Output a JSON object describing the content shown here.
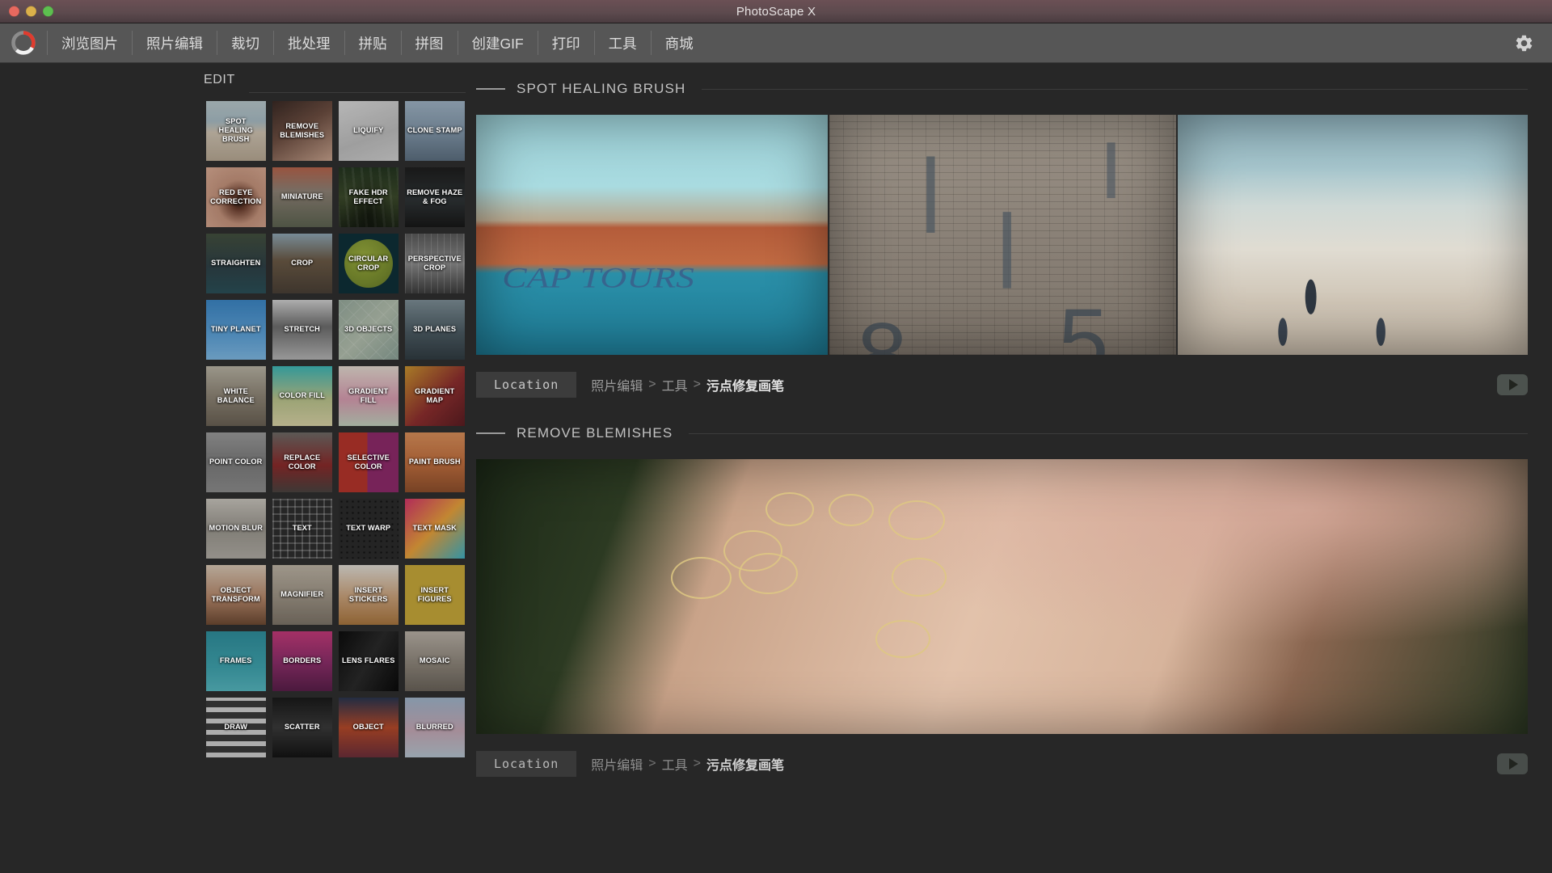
{
  "window": {
    "title": "PhotoScape X",
    "traffic_lights": [
      "close",
      "minimize",
      "maximize"
    ]
  },
  "menubar": {
    "logo": "photoscape-logo",
    "items": [
      {
        "label": "浏览图片"
      },
      {
        "label": "照片编辑"
      },
      {
        "label": "裁切"
      },
      {
        "label": "批处理"
      },
      {
        "label": "拼贴"
      },
      {
        "label": "拼图"
      },
      {
        "label": "创建GIF"
      },
      {
        "label": "打印"
      },
      {
        "label": "工具"
      },
      {
        "label": "商城"
      }
    ],
    "settings_icon": "gear-icon"
  },
  "sidebar": {
    "heading": "EDIT",
    "tiles": [
      {
        "label": "SPOT HEALING BRUSH",
        "art": "g-beach"
      },
      {
        "label": "REMOVE BLEMISHES",
        "art": "g-neck"
      },
      {
        "label": "LIQUIFY",
        "art": "g-liquify"
      },
      {
        "label": "CLONE STAMP",
        "art": "g-clone"
      },
      {
        "label": "RED EYE CORRECTION",
        "art": "g-eye"
      },
      {
        "label": "MINIATURE",
        "art": "g-mini"
      },
      {
        "label": "FAKE HDR EFFECT",
        "art": "g-hdr"
      },
      {
        "label": "REMOVE HAZE & FOG",
        "art": "g-haze"
      },
      {
        "label": "STRAIGHTEN",
        "art": "g-straight"
      },
      {
        "label": "CROP",
        "art": "g-crop"
      },
      {
        "label": "CIRCULAR CROP",
        "art": "g-circcrop"
      },
      {
        "label": "PERSPECTIVE CROP",
        "art": "g-persp"
      },
      {
        "label": "TINY PLANET",
        "art": "g-tiny"
      },
      {
        "label": "STRETCH",
        "art": "g-stretch"
      },
      {
        "label": "3D OBJECTS",
        "art": "g-3dobj"
      },
      {
        "label": "3D PLANES",
        "art": "g-3dpl"
      },
      {
        "label": "WHITE BALANCE",
        "art": "g-wb"
      },
      {
        "label": "COLOR FILL",
        "art": "g-cfill"
      },
      {
        "label": "GRADIENT FILL",
        "art": "g-gfill"
      },
      {
        "label": "GRADIENT MAP",
        "art": "g-gmap"
      },
      {
        "label": "POINT COLOR",
        "art": "g-pcolor"
      },
      {
        "label": "REPLACE COLOR",
        "art": "g-rcolor"
      },
      {
        "label": "SELECTIVE COLOR",
        "art": "g-scolor"
      },
      {
        "label": "PAINT BRUSH",
        "art": "g-paint"
      },
      {
        "label": "MOTION BLUR",
        "art": "g-motion"
      },
      {
        "label": "TEXT",
        "art": "g-text"
      },
      {
        "label": "TEXT WARP",
        "art": "g-twarp"
      },
      {
        "label": "TEXT MASK",
        "art": "g-tmask"
      },
      {
        "label": "OBJECT TRANSFORM",
        "art": "g-objtr"
      },
      {
        "label": "MAGNIFIER",
        "art": "g-magn"
      },
      {
        "label": "INSERT STICKERS",
        "art": "g-stick"
      },
      {
        "label": "INSERT FIGURES",
        "art": "g-figs"
      },
      {
        "label": "FRAMES",
        "art": "g-frames"
      },
      {
        "label": "BORDERS",
        "art": "g-borders"
      },
      {
        "label": "LENS FLARES",
        "art": "g-lens"
      },
      {
        "label": "MOSAIC",
        "art": "g-mosaic"
      },
      {
        "label": "DRAW",
        "art": "g-draw"
      },
      {
        "label": "SCATTER",
        "art": "g-scatter"
      },
      {
        "label": "OBJECT",
        "art": "g-object"
      },
      {
        "label": "BLURRED",
        "art": "g-blurred"
      }
    ]
  },
  "main": {
    "sections": [
      {
        "title": "SPOT HEALING BRUSH",
        "previews": [
          "cap-tours-pool-photo",
          "brick-wall-numbers-photo",
          "beach-waves-people-photo"
        ],
        "location": {
          "chip_label": "Location",
          "crumbs": [
            "照片编辑",
            "工具",
            "污点修复画笔"
          ],
          "separator": ">",
          "play_button": "play-icon"
        }
      },
      {
        "title": "REMOVE BLEMISHES",
        "previews": [
          "woman-face-blemish-circles-photo"
        ],
        "location": {
          "chip_label": "Location",
          "crumbs": [
            "照片编辑",
            "工具",
            "污点修复画笔"
          ],
          "separator": ">",
          "play_button": "play-icon"
        }
      }
    ]
  },
  "colors": {
    "titlebar_accent": "#5d4a4e",
    "menubar": "#565656",
    "background": "#272727",
    "panel_text": "#c2c2c2",
    "crumb_active": "#e3e3e3",
    "blemish_circle": "#dec882"
  }
}
